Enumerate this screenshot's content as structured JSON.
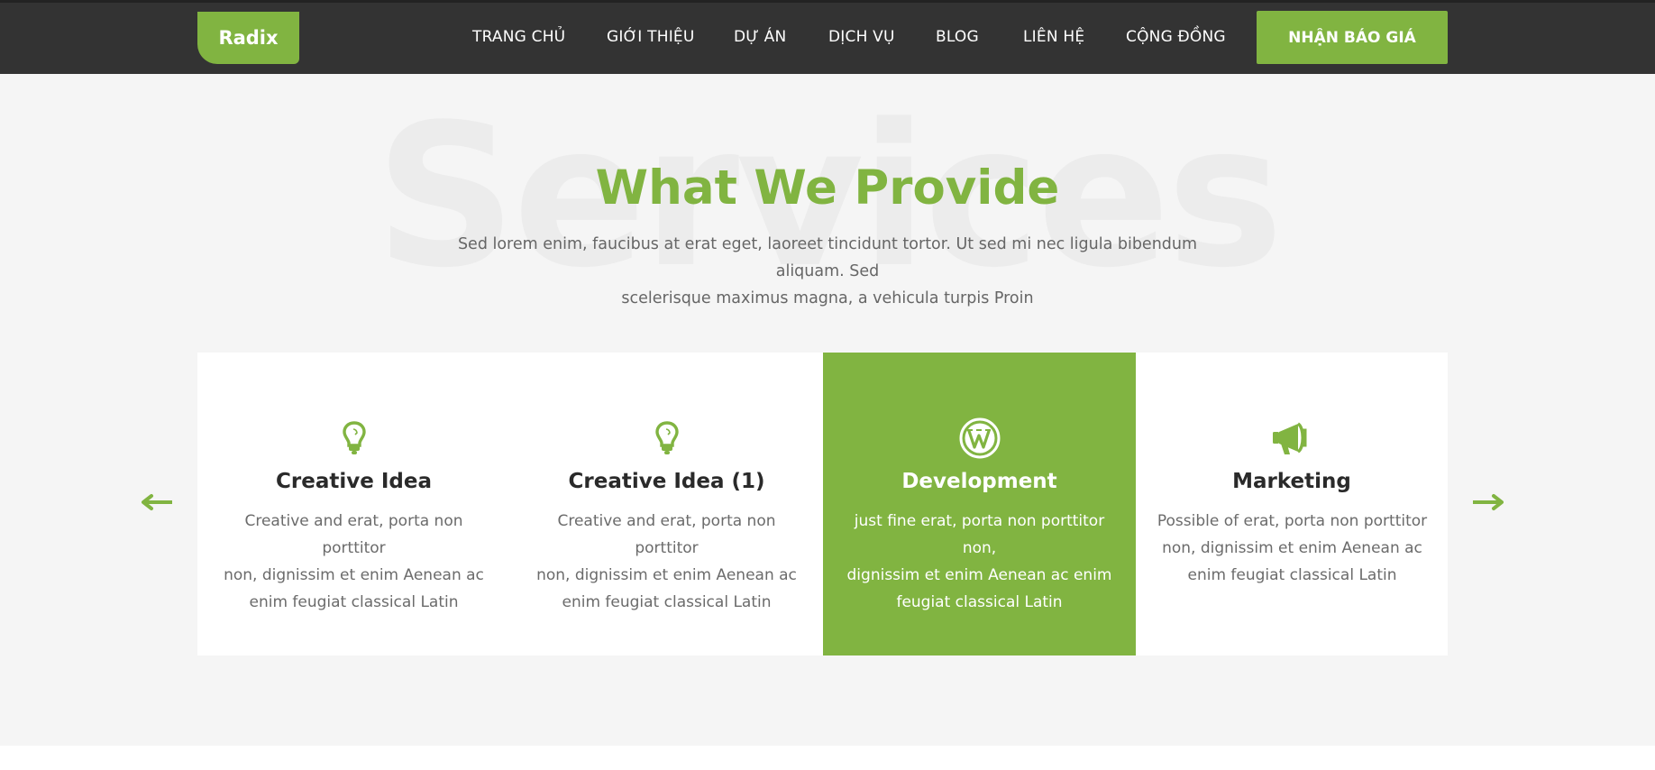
{
  "header": {
    "logo": "Radix",
    "nav": [
      "TRANG CHỦ",
      "GIỚI THIỆU",
      "DỰ ÁN",
      "DỊCH VỤ",
      "BLOG",
      "LIÊN HỆ",
      "CỘNG ĐỒNG"
    ],
    "cta_label": "NHẬN BÁO GIÁ"
  },
  "services": {
    "background_word": "Services",
    "heading": "What We Provide",
    "subtitle_line1": "Sed lorem enim, faucibus at erat eget, laoreet tincidunt tortor. Ut sed mi nec ligula bibendum aliquam. Sed",
    "subtitle_line2": "scelerisque maximus magna, a vehicula turpis Proin",
    "cards": [
      {
        "icon": "lightbulb-icon",
        "title": "Creative Idea",
        "desc_lines": [
          "Creative and erat, porta non porttitor",
          "non, dignissim et enim Aenean ac",
          "enim feugiat classical Latin"
        ]
      },
      {
        "icon": "lightbulb-icon",
        "title": "Creative Idea (1)",
        "desc_lines": [
          "Creative and erat, porta non porttitor",
          "non, dignissim et enim Aenean ac",
          "enim feugiat classical Latin"
        ]
      },
      {
        "icon": "wordpress-icon",
        "title": "Development",
        "desc_lines": [
          "just fine erat, porta non porttitor non,",
          "dignissim et enim Aenean ac enim",
          "feugiat classical Latin"
        ],
        "active": true
      },
      {
        "icon": "megaphone-icon",
        "title": "Marketing",
        "desc_lines": [
          "Possible of erat, porta non porttitor",
          "non, dignissim et enim Aenean ac",
          "enim feugiat classical Latin"
        ]
      }
    ],
    "prev_icon": "arrow-left-icon",
    "next_icon": "arrow-right-icon"
  },
  "colors": {
    "accent": "#81b441",
    "header_bg": "#333333",
    "section_bg": "#f5f5f5",
    "card_bg": "#ffffff",
    "heading_text": "#2a2a2a",
    "body_text": "#6b6b6b"
  }
}
